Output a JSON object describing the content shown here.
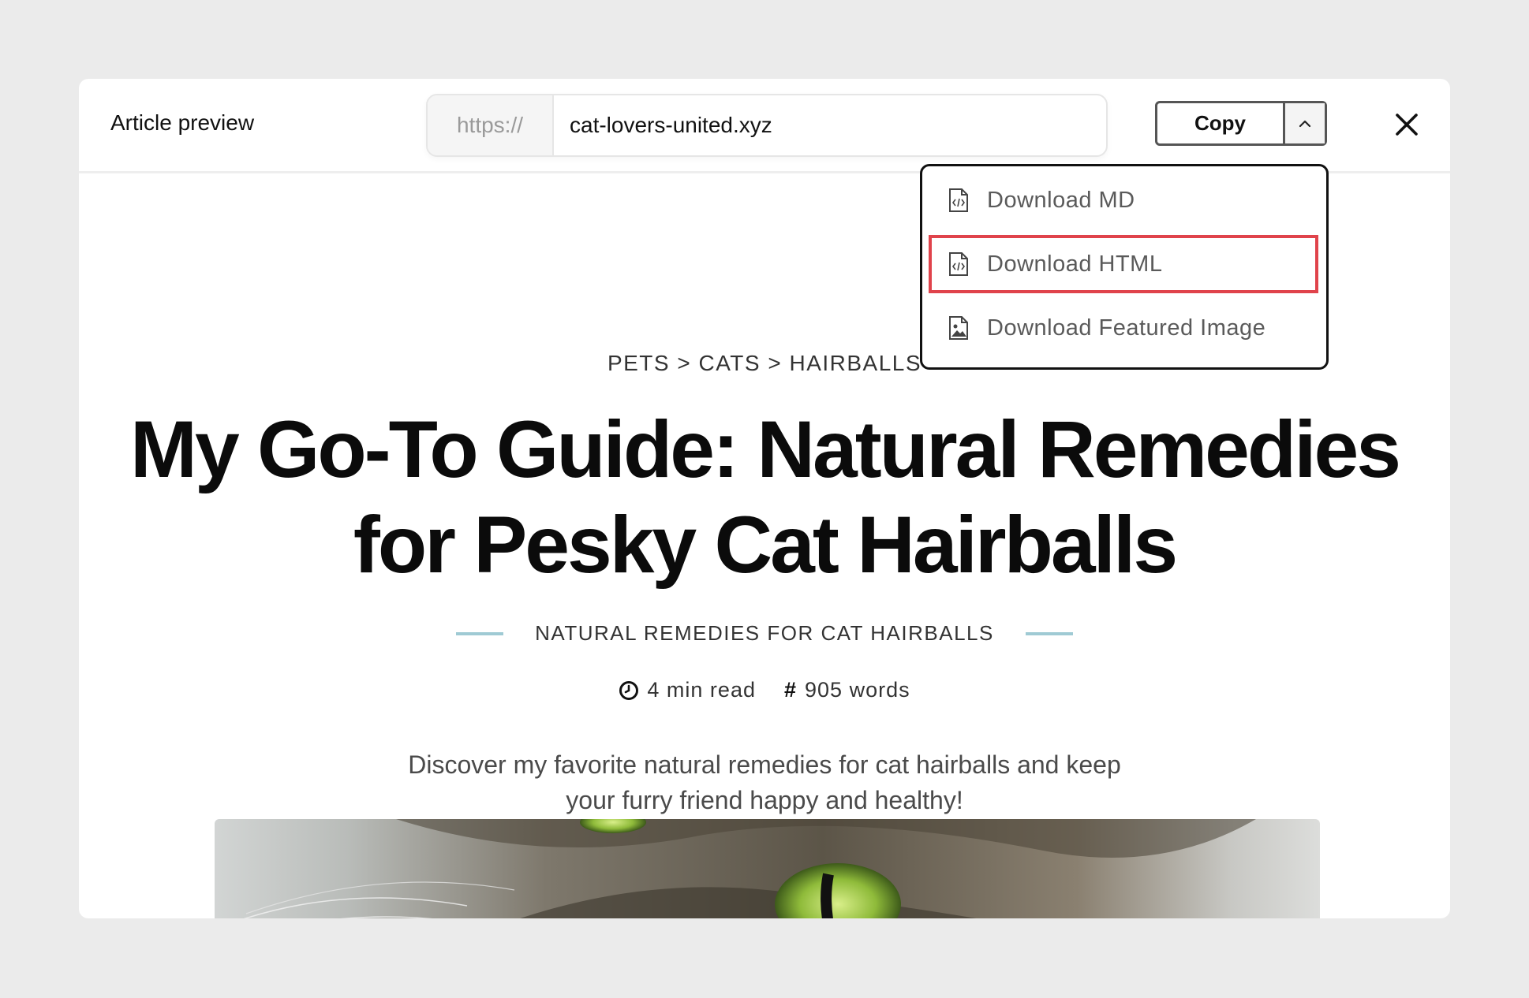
{
  "header": {
    "title": "Article preview",
    "url_prefix": "https://",
    "url_value": "cat-lovers-united.xyz",
    "copy_label": "Copy",
    "toggle_icon": "chevron-up-icon",
    "close_icon": "close-icon"
  },
  "dropdown": {
    "items": [
      {
        "label": "Download MD",
        "icon": "file-code-icon"
      },
      {
        "label": "Download HTML",
        "icon": "file-code-icon",
        "selected": true
      },
      {
        "label": "Download Featured Image",
        "icon": "file-image-icon"
      }
    ]
  },
  "article": {
    "breadcrumb": "PETS > CATS > HAIRBALLS",
    "headline": "My Go-To Guide: Natural Remedies for Pesky Cat Hairballs",
    "subtitle": "NATURAL REMEDIES FOR CAT HAIRBALLS",
    "read_time": "4 min read",
    "word_count_symbol": "#",
    "word_count": "905 words",
    "description": "Discover my favorite natural remedies for cat hairballs and keep your furry friend happy and healthy!"
  },
  "colors": {
    "accent_rule": "#9fcad4",
    "selection_outline": "#e0434b",
    "background": "#ebebeb"
  }
}
